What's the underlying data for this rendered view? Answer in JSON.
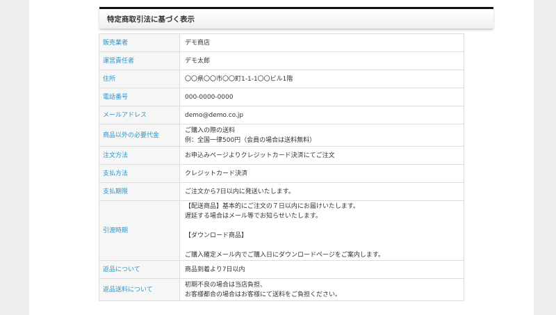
{
  "section": {
    "title": "特定商取引法に基づく表示"
  },
  "rows": [
    {
      "label": "販売業者",
      "lines": [
        "デモ商店"
      ]
    },
    {
      "label": "運営責任者",
      "lines": [
        "デモ太郎"
      ]
    },
    {
      "label": "住所",
      "lines": [
        "〇〇県〇〇市〇〇町1-1-1〇〇ビル1階"
      ]
    },
    {
      "label": "電話番号",
      "lines": [
        "000-0000-0000"
      ]
    },
    {
      "label": "メールアドレス",
      "lines": [
        "demo@demo.co.jp"
      ]
    },
    {
      "label": "商品以外の必要代金",
      "lines": [
        "ご購入の際の送料",
        "例：全国一律500円（会員の場合は送料無料）"
      ]
    },
    {
      "label": "注文方法",
      "lines": [
        "お申込みページよりクレジットカード決済にてご注文"
      ]
    },
    {
      "label": "支払方法",
      "lines": [
        "クレジットカード決済"
      ]
    },
    {
      "label": "支払期限",
      "lines": [
        "ご注文から7日以内に発送いたします。"
      ]
    },
    {
      "label": "引渡時期",
      "lines": [
        "【配送商品】基本的にご注文の７日以内にお届けいたします。",
        "遅延する場合はメール等でお知らせいたします。",
        "",
        "【ダウンロード商品】",
        "",
        "ご購入確定メール内でご購入日にダウンロードページをご案内します。"
      ]
    },
    {
      "label": "返品について",
      "lines": [
        "商品到着より7日以内"
      ]
    },
    {
      "label": "返品送料について",
      "lines": [
        "初期不良の場合は当店負担、",
        "お客様都合の場合はお客様にて送料をご負担ください。"
      ]
    }
  ]
}
